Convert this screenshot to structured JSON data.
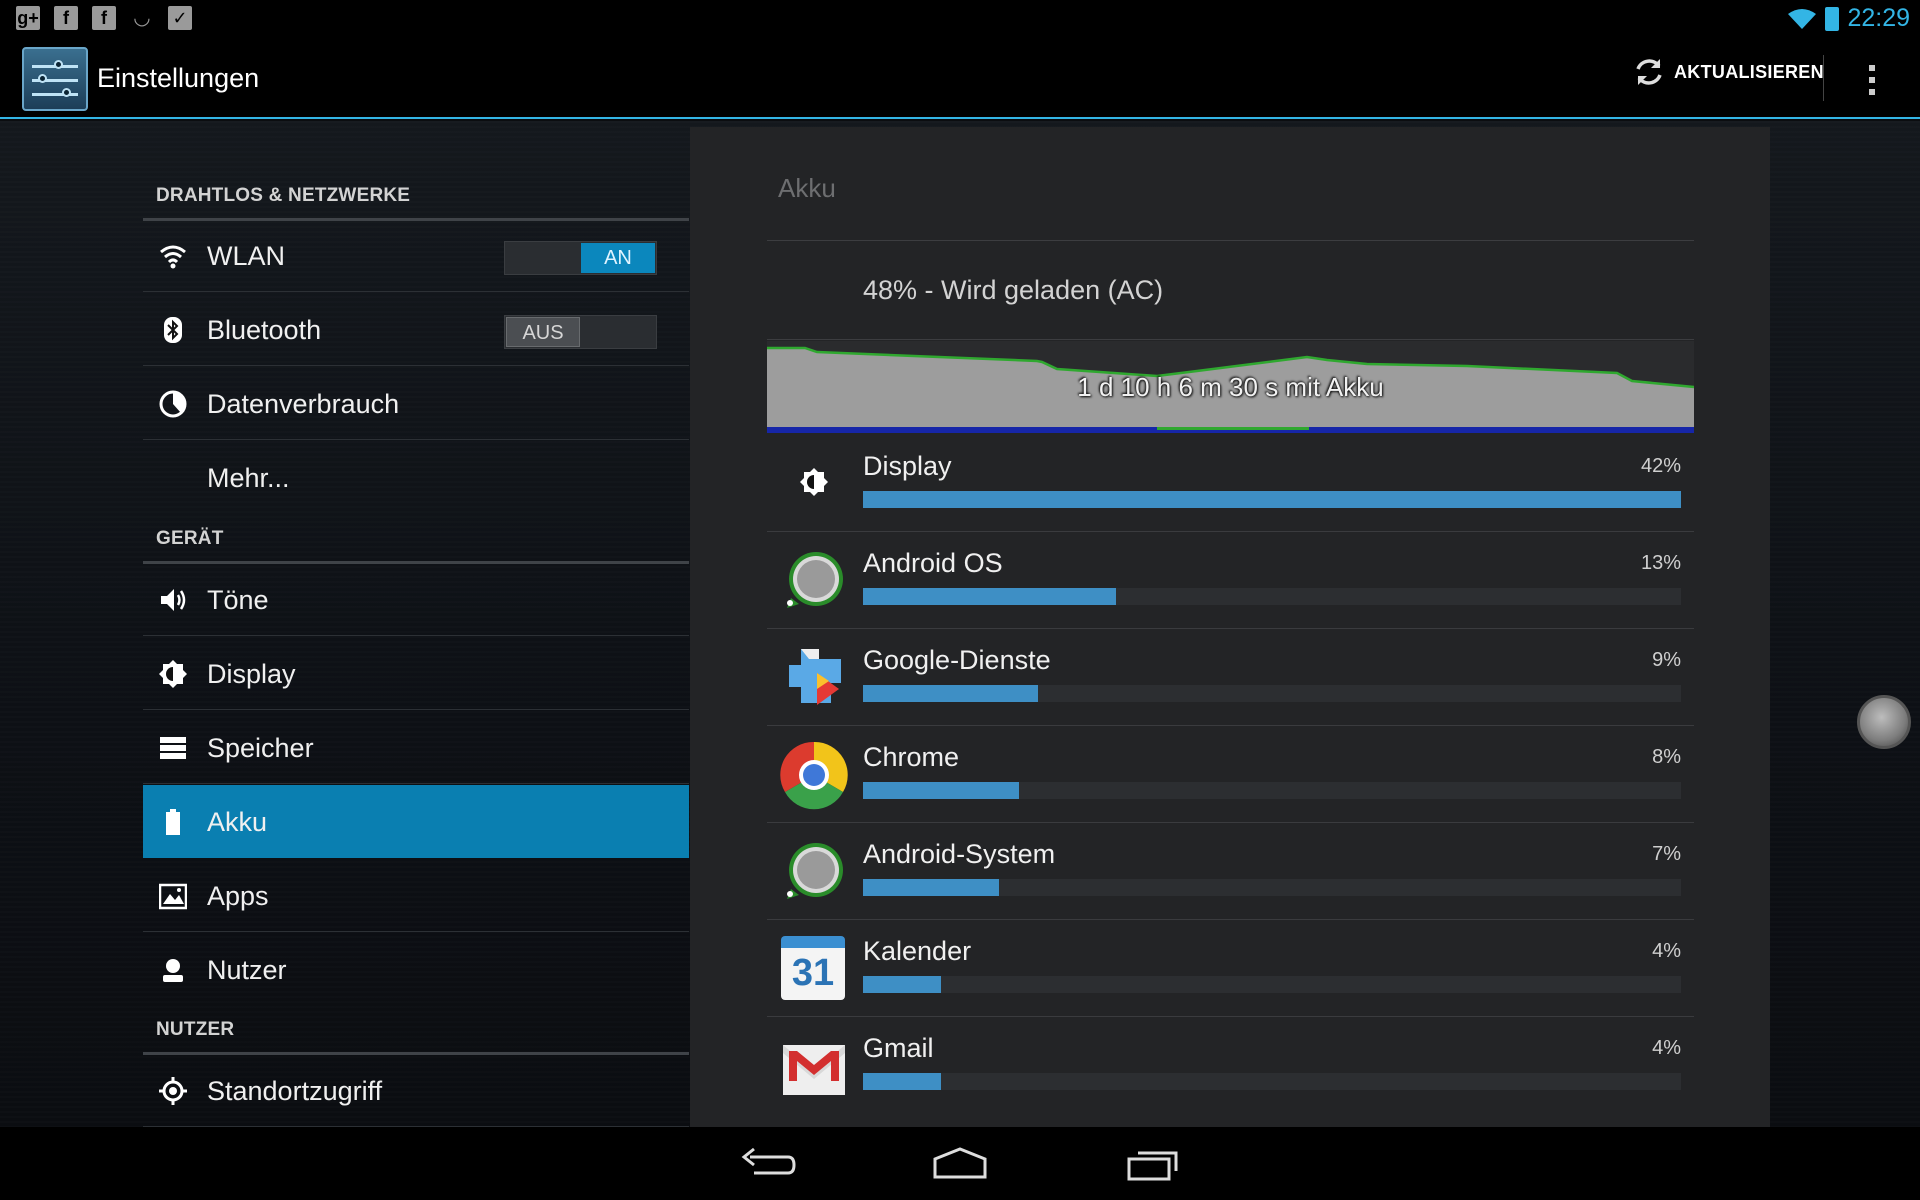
{
  "status_bar": {
    "time": "22:29",
    "left_icons": [
      "google-plus-icon",
      "facebook-icon",
      "facebook-icon",
      "eye-icon",
      "bag-icon"
    ],
    "right_icons": [
      "wifi-icon",
      "battery-charging-icon"
    ]
  },
  "action_bar": {
    "title": "Einstellungen",
    "refresh_label": "AKTUALISIEREN"
  },
  "sidebar": {
    "sections": [
      {
        "header": "DRAHTLOS & NETZWERKE",
        "items": [
          {
            "label": "WLAN",
            "icon": "wifi-icon",
            "toggle": "AN"
          },
          {
            "label": "Bluetooth",
            "icon": "bluetooth-icon",
            "toggle": "AUS"
          },
          {
            "label": "Datenverbrauch",
            "icon": "data-usage-icon"
          },
          {
            "label": "Mehr...",
            "icon": ""
          }
        ]
      },
      {
        "header": "GERÄT",
        "items": [
          {
            "label": "Töne",
            "icon": "speaker-icon"
          },
          {
            "label": "Display",
            "icon": "brightness-icon"
          },
          {
            "label": "Speicher",
            "icon": "storage-icon"
          },
          {
            "label": "Akku",
            "icon": "battery-icon",
            "selected": true
          },
          {
            "label": "Apps",
            "icon": "apps-icon"
          },
          {
            "label": "Nutzer",
            "icon": "user-icon"
          }
        ]
      },
      {
        "header": "NUTZER",
        "items": [
          {
            "label": "Standortzugriff",
            "icon": "location-icon"
          }
        ]
      }
    ]
  },
  "panel": {
    "title": "Akku",
    "battery_status": "48% - Wird geladen (AC)",
    "graph_label": "1 d 10 h 6 m 30 s mit Akku",
    "graph_level": 0.48,
    "usage": [
      {
        "name": "Display",
        "percent": "42%",
        "value": 42,
        "icon": "brightness-icon"
      },
      {
        "name": "Android OS",
        "percent": "13%",
        "value": 13,
        "icon": "android-os-icon"
      },
      {
        "name": "Google-Dienste",
        "percent": "9%",
        "value": 9,
        "icon": "google-services-icon"
      },
      {
        "name": "Chrome",
        "percent": "8%",
        "value": 8,
        "icon": "chrome-icon"
      },
      {
        "name": "Android-System",
        "percent": "7%",
        "value": 7,
        "icon": "android-system-icon"
      },
      {
        "name": "Kalender",
        "percent": "4%",
        "value": 4,
        "icon": "calendar-icon",
        "icon_text": "31"
      },
      {
        "name": "Gmail",
        "percent": "4%",
        "value": 4,
        "icon": "gmail-icon"
      }
    ]
  },
  "nav_bar": {
    "buttons": [
      "back-icon",
      "home-icon",
      "recents-icon"
    ]
  },
  "colors": {
    "accent": "#33b5e5",
    "selected_row": "#0a7fb1",
    "usage_bar": "#3e8fc5",
    "graph_line": "#2fa82f"
  }
}
